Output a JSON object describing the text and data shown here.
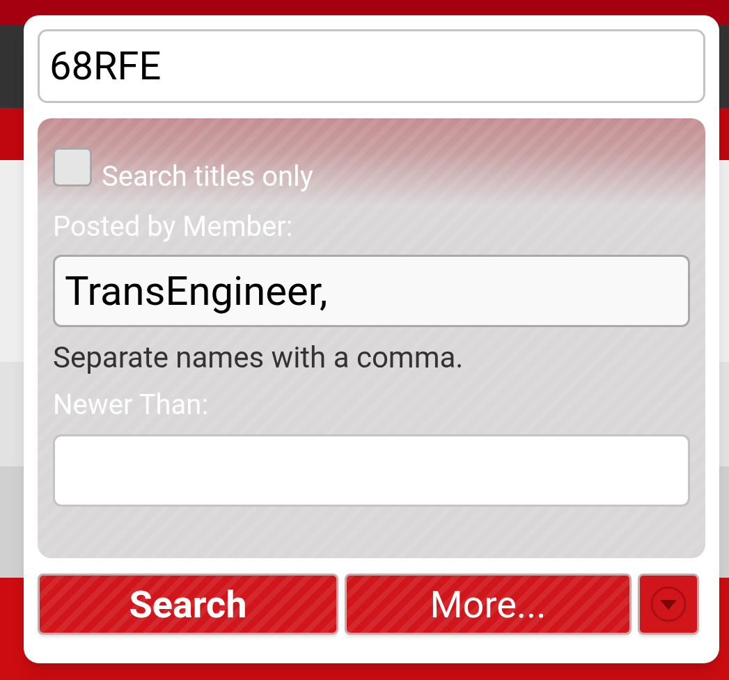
{
  "search_popup": {
    "query": {
      "value": "68RFE"
    },
    "options": {
      "titles_only": {
        "label": "Search titles only",
        "checked": false
      },
      "member": {
        "label": "Posted by Member:",
        "value": "TransEngineer,",
        "hint": "Separate names with a comma."
      },
      "newer_than": {
        "label": "Newer Than:"
      }
    },
    "buttons": [
      {
        "label": "Search",
        "kind": "submit"
      },
      {
        "label": "More...",
        "kind": "more"
      },
      {
        "kind": "menu"
      }
    ]
  }
}
